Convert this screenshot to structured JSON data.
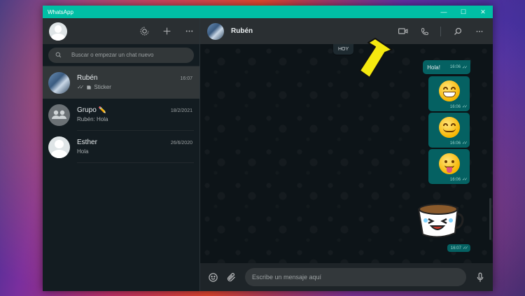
{
  "window": {
    "title": "WhatsApp",
    "minimize": "—",
    "maximize": "☐",
    "close": "✕"
  },
  "sidebar": {
    "search_placeholder": "Buscar o empezar un chat nuevo",
    "chats": [
      {
        "name": "Rubén",
        "time": "16:07",
        "preview": "Sticker",
        "has_ticks": true,
        "has_sticker_icon": true
      },
      {
        "name": "Grupo",
        "time": "18/2/2021",
        "preview": "Rubén: Hola",
        "emoji": "✏️"
      },
      {
        "name": "Esther",
        "time": "26/6/2020",
        "preview": "Hola"
      }
    ]
  },
  "conversation": {
    "contact_name": "Rubén",
    "date_chip": "HOY",
    "messages": [
      {
        "type": "text",
        "text": "Hola!",
        "time": "16:06"
      },
      {
        "type": "emoji",
        "emoji": "grinning-face",
        "time": "16:06"
      },
      {
        "type": "emoji",
        "emoji": "smiling-face",
        "time": "16:06"
      },
      {
        "type": "emoji",
        "emoji": "tongue-face",
        "time": "16:06"
      },
      {
        "type": "sticker",
        "sticker": "laughing-cup-sticker",
        "time": "16:07"
      }
    ],
    "compose_placeholder": "Escribe un mensaje aquí"
  },
  "colors": {
    "titlebar": "#00bfa5",
    "outgoing_bubble": "#056162",
    "annotation_arrow": "#f5e90f"
  }
}
